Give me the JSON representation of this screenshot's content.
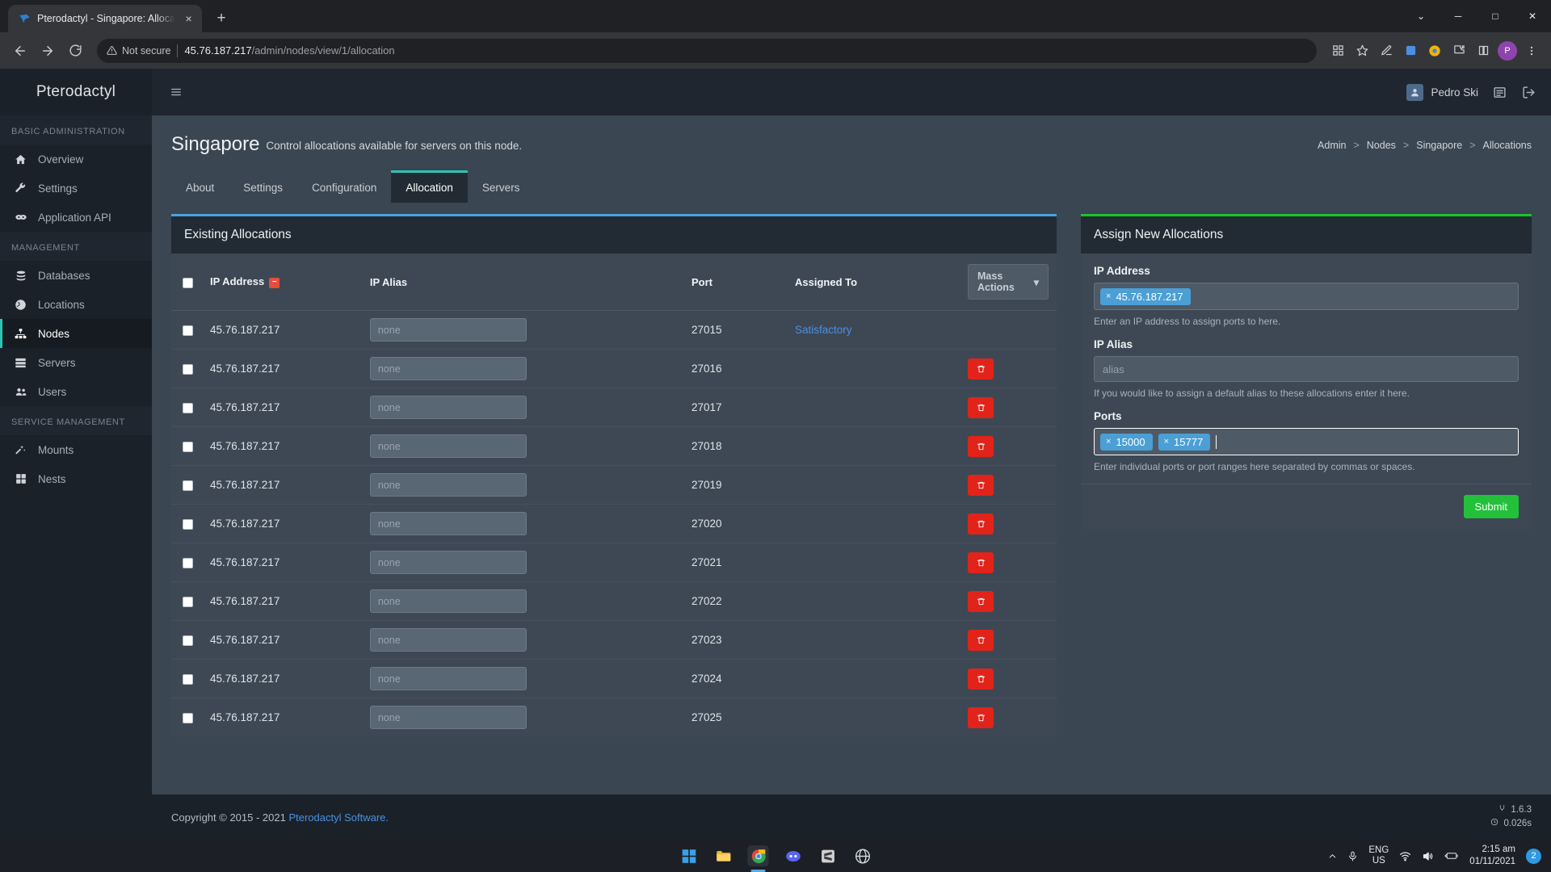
{
  "browser": {
    "tab": {
      "title": "Pterodactyl - Singapore: Allocatio",
      "favicon": "pterodactyl-icon",
      "close": "×"
    },
    "new_tab": "+",
    "window_controls": {
      "minimize": "─",
      "maximize": "□",
      "close": "✕",
      "chevron": "⌄"
    },
    "nav": {
      "back": "←",
      "forward": "→",
      "reload": "↻"
    },
    "omnibox": {
      "security_label": "Not secure",
      "url_host": "45.76.187.217",
      "url_path": "/admin/nodes/view/1/allocation"
    },
    "toolbar_right": {
      "avatar_letter": "P"
    }
  },
  "app": {
    "brand": "Pterodactyl",
    "user_name": "Pedro Ski"
  },
  "sidebar": {
    "sections": [
      {
        "label": "BASIC ADMINISTRATION",
        "items": [
          {
            "label": "Overview",
            "icon": "home-icon",
            "active": false
          },
          {
            "label": "Settings",
            "icon": "wrench-icon",
            "active": false
          },
          {
            "label": "Application API",
            "icon": "link-icon",
            "active": false
          }
        ]
      },
      {
        "label": "MANAGEMENT",
        "items": [
          {
            "label": "Databases",
            "icon": "database-icon",
            "active": false
          },
          {
            "label": "Locations",
            "icon": "globe-icon",
            "active": false
          },
          {
            "label": "Nodes",
            "icon": "sitemap-icon",
            "active": true
          },
          {
            "label": "Servers",
            "icon": "server-icon",
            "active": false
          },
          {
            "label": "Users",
            "icon": "users-icon",
            "active": false
          }
        ]
      },
      {
        "label": "SERVICE MANAGEMENT",
        "items": [
          {
            "label": "Mounts",
            "icon": "magic-wand-icon",
            "active": false
          },
          {
            "label": "Nests",
            "icon": "grid-icon",
            "active": false
          }
        ]
      }
    ]
  },
  "page": {
    "title": "Singapore",
    "subtitle": "Control allocations available for servers on this node.",
    "breadcrumb": [
      "Admin",
      "Nodes",
      "Singapore",
      "Allocations"
    ],
    "breadcrumb_separator": ">",
    "tabs": [
      {
        "label": "About",
        "active": false
      },
      {
        "label": "Settings",
        "active": false
      },
      {
        "label": "Configuration",
        "active": false
      },
      {
        "label": "Allocation",
        "active": true
      },
      {
        "label": "Servers",
        "active": false
      }
    ]
  },
  "existing_allocations": {
    "panel_title": "Existing Allocations",
    "columns": [
      "IP Address",
      "IP Alias",
      "Port",
      "Assigned To"
    ],
    "header_badge": "−",
    "mass_actions_label": "Mass Actions",
    "mass_actions_caret": "▾",
    "alias_placeholder": "none",
    "delete_icon": "trash-icon",
    "rows": [
      {
        "ip": "45.76.187.217",
        "alias": "",
        "port": "27015",
        "assigned_to": "Satisfactory",
        "deletable": false
      },
      {
        "ip": "45.76.187.217",
        "alias": "",
        "port": "27016",
        "assigned_to": "",
        "deletable": true
      },
      {
        "ip": "45.76.187.217",
        "alias": "",
        "port": "27017",
        "assigned_to": "",
        "deletable": true
      },
      {
        "ip": "45.76.187.217",
        "alias": "",
        "port": "27018",
        "assigned_to": "",
        "deletable": true
      },
      {
        "ip": "45.76.187.217",
        "alias": "",
        "port": "27019",
        "assigned_to": "",
        "deletable": true
      },
      {
        "ip": "45.76.187.217",
        "alias": "",
        "port": "27020",
        "assigned_to": "",
        "deletable": true
      },
      {
        "ip": "45.76.187.217",
        "alias": "",
        "port": "27021",
        "assigned_to": "",
        "deletable": true
      },
      {
        "ip": "45.76.187.217",
        "alias": "",
        "port": "27022",
        "assigned_to": "",
        "deletable": true
      },
      {
        "ip": "45.76.187.217",
        "alias": "",
        "port": "27023",
        "assigned_to": "",
        "deletable": true
      },
      {
        "ip": "45.76.187.217",
        "alias": "",
        "port": "27024",
        "assigned_to": "",
        "deletable": true
      },
      {
        "ip": "45.76.187.217",
        "alias": "",
        "port": "27025",
        "assigned_to": "",
        "deletable": true
      }
    ]
  },
  "assign_new": {
    "panel_title": "Assign New Allocations",
    "ip_address": {
      "label": "IP Address",
      "tags": [
        "45.76.187.217"
      ],
      "help": "Enter an IP address to assign ports to here."
    },
    "ip_alias": {
      "label": "IP Alias",
      "value": "",
      "placeholder": "alias",
      "help": "If you would like to assign a default alias to these allocations enter it here."
    },
    "ports": {
      "label": "Ports",
      "tags": [
        "15000",
        "15777"
      ],
      "help": "Enter individual ports or port ranges here separated by commas or spaces."
    },
    "submit_label": "Submit",
    "tag_remove": "×"
  },
  "footer": {
    "copyright": "Copyright © 2015 - 2021",
    "link": "Pterodactyl Software.",
    "version": "1.6.3",
    "load_time": "0.026s"
  },
  "taskbar": {
    "apps": [
      "windows-start-icon",
      "file-explorer-icon",
      "chrome-icon",
      "discord-icon",
      "sublime-icon",
      "browser-icon"
    ],
    "tray": {
      "chevron": "⌃",
      "mic": "mic-icon",
      "language_line1": "ENG",
      "language_line2": "US",
      "wifi": "wifi-icon",
      "volume": "volume-icon",
      "battery": "battery-charging-icon",
      "time": "2:15 am",
      "date": "01/11/2021",
      "notification_count": "2"
    }
  },
  "colors": {
    "accent_teal": "#2cc4b5",
    "panel_blue": "#4aa3df",
    "panel_green": "#19c52b",
    "danger_red": "#e2231a",
    "tag_blue": "#4b9fd5",
    "link_blue": "#4a90e2",
    "submit_green": "#23c13a"
  }
}
